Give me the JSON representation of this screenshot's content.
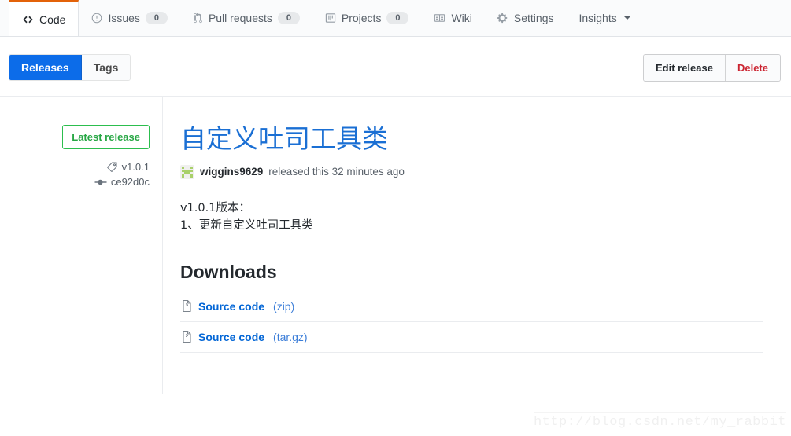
{
  "repo_nav": {
    "items": [
      {
        "label": "Code",
        "icon": "code-icon",
        "count": null,
        "selected": true,
        "caret": false
      },
      {
        "label": "Issues",
        "icon": "issue-icon",
        "count": "0",
        "selected": false,
        "caret": false
      },
      {
        "label": "Pull requests",
        "icon": "git-pull-icon",
        "count": "0",
        "selected": false,
        "caret": false
      },
      {
        "label": "Projects",
        "icon": "project-icon",
        "count": "0",
        "selected": false,
        "caret": false
      },
      {
        "label": "Wiki",
        "icon": "book-icon",
        "count": null,
        "selected": false,
        "caret": false
      },
      {
        "label": "Settings",
        "icon": "gear-icon",
        "count": null,
        "selected": false,
        "caret": false
      },
      {
        "label": "Insights",
        "icon": null,
        "count": null,
        "selected": false,
        "caret": true
      }
    ],
    "active_accent_color": "#e36209"
  },
  "subheader": {
    "segments": [
      {
        "label": "Releases",
        "active": true
      },
      {
        "label": "Tags",
        "active": false
      }
    ],
    "actions": [
      {
        "label": "Edit release",
        "style": "default"
      },
      {
        "label": "Delete",
        "style": "danger"
      }
    ],
    "active_segment_color": "#0c6ce9",
    "danger_color": "#cb2431"
  },
  "release": {
    "badge": "Latest release",
    "badge_color": "#28a745",
    "tag": "v1.0.1",
    "tag_icon": "tag-icon",
    "commit": "ce92d0c",
    "commit_icon": "commit-icon",
    "title": "自定义吐司工具类",
    "title_color": "#1a6fd4",
    "author": "wiggins9629",
    "author_avatar": "identicon-avatar",
    "meta_text": "released this 32 minutes ago",
    "notes": [
      "v1.0.1版本：",
      "1、更新自定义吐司工具类"
    ]
  },
  "downloads": {
    "heading": "Downloads",
    "items": [
      {
        "icon": "file-zip-icon",
        "name": "Source code",
        "ext": "(zip)"
      },
      {
        "icon": "file-zip-icon",
        "name": "Source code",
        "ext": "(tar.gz)"
      }
    ]
  },
  "watermark": {
    "text": "http://blog.csdn.net/my_rabbit"
  }
}
